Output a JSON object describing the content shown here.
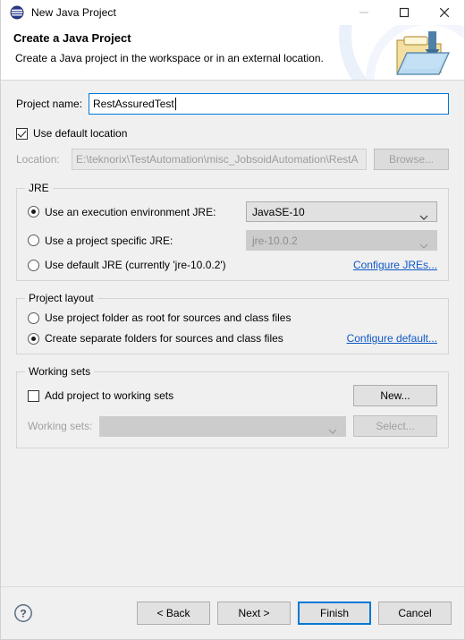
{
  "window": {
    "title": "New Java Project",
    "icon": "eclipse-sphere-icon",
    "controls": {
      "minimize": "minimize-icon",
      "maximize": "maximize-icon",
      "close": "close-icon"
    }
  },
  "banner": {
    "title": "Create a Java Project",
    "subtitle": "Create a Java project in the workspace or in an external location.",
    "icon": "java-project-folder-icon"
  },
  "project_name": {
    "label": "Project name:",
    "value": "RestAssuredTest"
  },
  "default_location": {
    "label": "Use default location",
    "checked": true
  },
  "location": {
    "label": "Location:",
    "value": "E:\\teknorix\\TestAutomation\\misc_JobsoidAutomation\\RestA",
    "browse_label": "Browse...",
    "enabled": false
  },
  "jre": {
    "group_title": "JRE",
    "options": [
      {
        "label": "Use an execution environment JRE:",
        "selected": true
      },
      {
        "label": "Use a project specific JRE:",
        "selected": false
      },
      {
        "label": "Use default JRE (currently 'jre-10.0.2')",
        "selected": false
      }
    ],
    "execution_environment": {
      "value": "JavaSE-10",
      "enabled": true
    },
    "project_specific": {
      "value": "jre-10.0.2",
      "enabled": false
    },
    "configure_link": "Configure JREs..."
  },
  "project_layout": {
    "group_title": "Project layout",
    "options": [
      {
        "label": "Use project folder as root for sources and class files",
        "selected": false
      },
      {
        "label": "Create separate folders for sources and class files",
        "selected": true
      }
    ],
    "configure_link": "Configure default..."
  },
  "working_sets": {
    "group_title": "Working sets",
    "add_checkbox": {
      "label": "Add project to working sets",
      "checked": false
    },
    "new_button": "New...",
    "sets_label": "Working sets:",
    "sets_value": "",
    "select_button": "Select...",
    "enabled": false
  },
  "footer": {
    "help_icon": "help-icon",
    "back_label": "< Back",
    "next_label": "Next >",
    "finish_label": "Finish",
    "cancel_label": "Cancel"
  },
  "colors": {
    "accent": "#0078d7",
    "link": "#0f59c7",
    "window_bg": "#f0f0f0",
    "banner_bg": "#ffffff"
  }
}
